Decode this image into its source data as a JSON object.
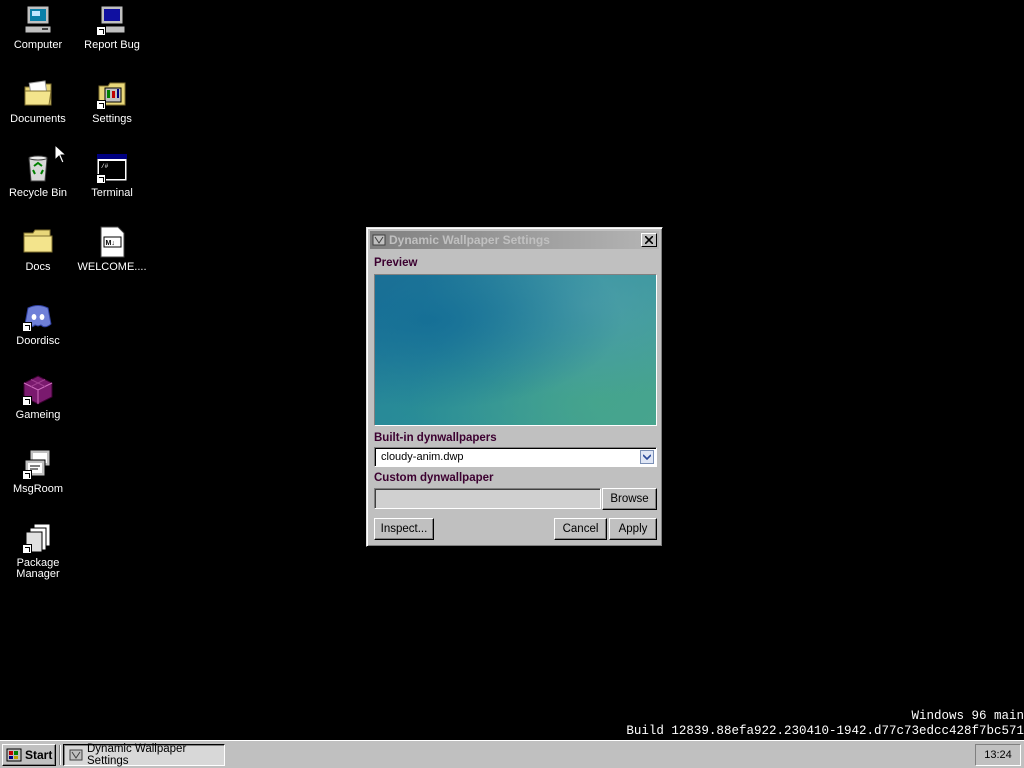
{
  "desktop": {
    "icons": [
      {
        "label": "Computer",
        "icon": "computer-icon"
      },
      {
        "label": "Report Bug",
        "icon": "report-bug-icon"
      },
      {
        "label": "Documents",
        "icon": "documents-folder-icon"
      },
      {
        "label": "Settings",
        "icon": "settings-icon"
      },
      {
        "label": "Recycle Bin",
        "icon": "recycle-bin-icon"
      },
      {
        "label": "Terminal",
        "icon": "terminal-icon"
      },
      {
        "label": "Docs",
        "icon": "folder-icon"
      },
      {
        "label": "WELCOME....",
        "icon": "markdown-file-icon"
      },
      {
        "label": "Doordisc",
        "icon": "discord-icon"
      },
      {
        "label": "Gameing",
        "icon": "game-icon"
      },
      {
        "label": "MsgRoom",
        "icon": "msgroom-icon"
      },
      {
        "label": "Package\nManager",
        "icon": "package-manager-icon"
      }
    ]
  },
  "window": {
    "title": "Dynamic Wallpaper Settings",
    "preview_label": "Preview",
    "builtin_label": "Built-in dynwallpapers",
    "builtin_selected": "cloudy-anim.dwp",
    "custom_label": "Custom dynwallpaper",
    "custom_value": "",
    "browse_label": "Browse",
    "inspect_label": "Inspect...",
    "cancel_label": "Cancel",
    "apply_label": "Apply"
  },
  "build_info": {
    "line1": "Windows 96 main",
    "line2": "Build 12839.88efa922.230410-1942.d77c73edcc428f7bc571"
  },
  "taskbar": {
    "start_label": "Start",
    "task_label": "Dynamic Wallpaper Settings",
    "clock": "13:24"
  }
}
